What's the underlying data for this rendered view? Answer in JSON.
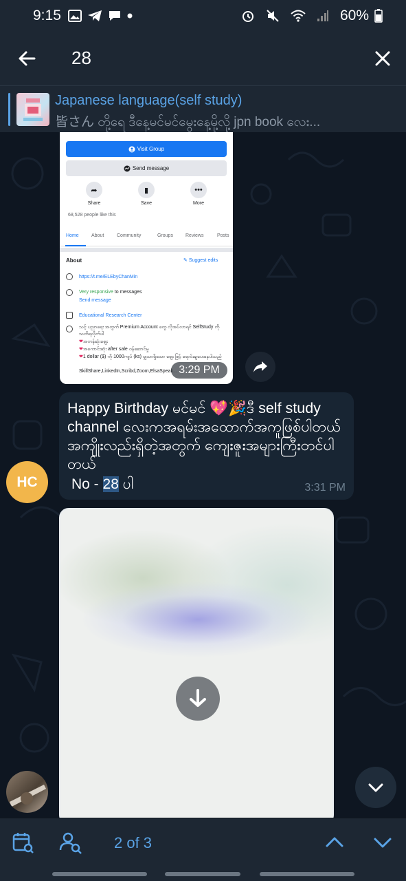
{
  "status_bar": {
    "time": "9:15",
    "battery": "60%"
  },
  "search": {
    "query": "28"
  },
  "pinned": {
    "title": "Japanese language(self study)",
    "subtitle": "皆さん တို့ရေ  ဒီနေ့မင်မင်မွေးနေ့မို့လို့ jpn book လေး..."
  },
  "screenshot": {
    "visit_group": "Visit Group",
    "send_message": "Send message",
    "share": "Share",
    "save": "Save",
    "more": "More",
    "likes": "68,528 people like this",
    "tabs": [
      "Home",
      "About",
      "Community",
      "Groups",
      "Reviews",
      "Posts"
    ],
    "about": "About",
    "suggest_edits": "Suggest edits",
    "link": "https://t.me/ELEbyChanMin",
    "very_responsive": "Very responsive",
    "to_messages": " to messages",
    "send_message_link": "Send message",
    "category": "Educational Research Center",
    "desc1": "သင့် ပညာရေး အတွက် Premium Account တွေ လိုအပ်လာရင် SelfStudy ကို သတိရလိုက်ပါ",
    "desc2": "အတန်ဆုံးဈေး",
    "desc3": "အကောင်းဆုံး after sale ဝန်ဆောင်မှု",
    "desc4": "1 dollar ($) ကို 1000ကျပ် (ks) မျှသာရှိသော ဈေး ဖြင့် ရောင်းချပေးနေပါသည်",
    "desc5": "SkillShare,LinkedIn,Scribd,Zoom,ElsaSpeak...",
    "time": "3:29 PM"
  },
  "message": {
    "text": "Happy Birthday မင်မင် 💖🎉ဒီ self  study channel လေးကအရမ်းအထောက်အကူဖြစ်ပါတယ် အကျိုးလည်းရှိတဲ့အတွက် ကျေးဇူးအများကြီးတင်ပါတယ်",
    "no_prefix": "No - ",
    "no_highlight": "28",
    "no_suffix": " ပါ",
    "time": "3:31 PM",
    "avatar_initials": "HC"
  },
  "bottom_bar": {
    "counter": "2 of 3"
  },
  "colors": {
    "background": "#0e1621",
    "bar": "#1d2733",
    "bubble": "#182533",
    "accent": "#5aa3e6",
    "avatar": "#f2b64b"
  }
}
